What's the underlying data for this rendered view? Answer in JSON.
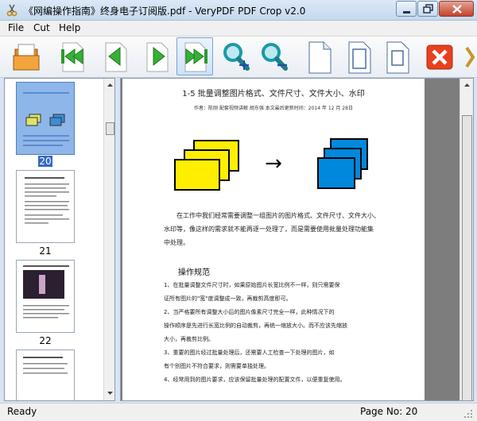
{
  "window": {
    "title": "《网编操作指南》终身电子订阅版.pdf - VeryPDF PDF Crop v2.0"
  },
  "menu": {
    "items": [
      {
        "label": "File"
      },
      {
        "label": "Cut"
      },
      {
        "label": "Help"
      }
    ]
  },
  "toolbar": {
    "buttons": [
      {
        "icon": "open-folder-icon"
      },
      {
        "icon": "first-page-icon"
      },
      {
        "icon": "previous-page-icon"
      },
      {
        "icon": "next-page-icon"
      },
      {
        "icon": "last-page-icon"
      },
      {
        "icon": "zoom-in-icon"
      },
      {
        "icon": "zoom-out-icon"
      },
      {
        "icon": "page-view-icon"
      },
      {
        "icon": "page-view-icon"
      },
      {
        "icon": "page-view-icon"
      },
      {
        "icon": "close-file-icon"
      }
    ]
  },
  "thumbnails": {
    "pages": [
      {
        "label": "20",
        "selected": true
      },
      {
        "label": "21",
        "selected": false
      },
      {
        "label": "22",
        "selected": false
      },
      {
        "label": "",
        "selected": false
      }
    ]
  },
  "document": {
    "title": "1-5 批量调整图片格式、文件尺寸、文件大小、水印",
    "meta": "作者：陈刚    配套视频讲解    胡东强    本文最后更新时间：2014 年 12 月 28日",
    "para1": [
      "在工作中我们经常需要调整一组图片的图片格式、文件尺寸、文件大小、",
      "水印等，像这样的需求就不能再逐一处理了，而是需要使用批量处理功能集",
      "中处理。"
    ],
    "heading": "操作规范",
    "list": [
      "    1、在批量调整文件尺寸时，如果原始图片长宽比例不一样，则只需要保",
      "证所有图片的\"宽\"度调整成一致，再裁剪高度即可。",
      "    2、当严格要所有调整大小后的图片像素尺寸完全一样，此种情况下的",
      "操作顺序是先进行长宽比例的自动裁剪，再统一缩放大小。而不应该先缩放",
      "大小，再裁剪比例。",
      "    3、重要的图片经过批量处理后，还需要人工检查一下处理的图片，如",
      "有个别图片不符合要求，则需要单独处理。",
      "    4、经常用到的图片要求，应该保留批量处理的配置文件，以便重复使用。"
    ],
    "arrow_glyph": "→"
  },
  "colors": {
    "yellow": "#ffee00",
    "blue": "#0088dd",
    "selection": "#3169c6"
  },
  "status": {
    "text": "Ready",
    "page_no": "Page No: 20"
  }
}
